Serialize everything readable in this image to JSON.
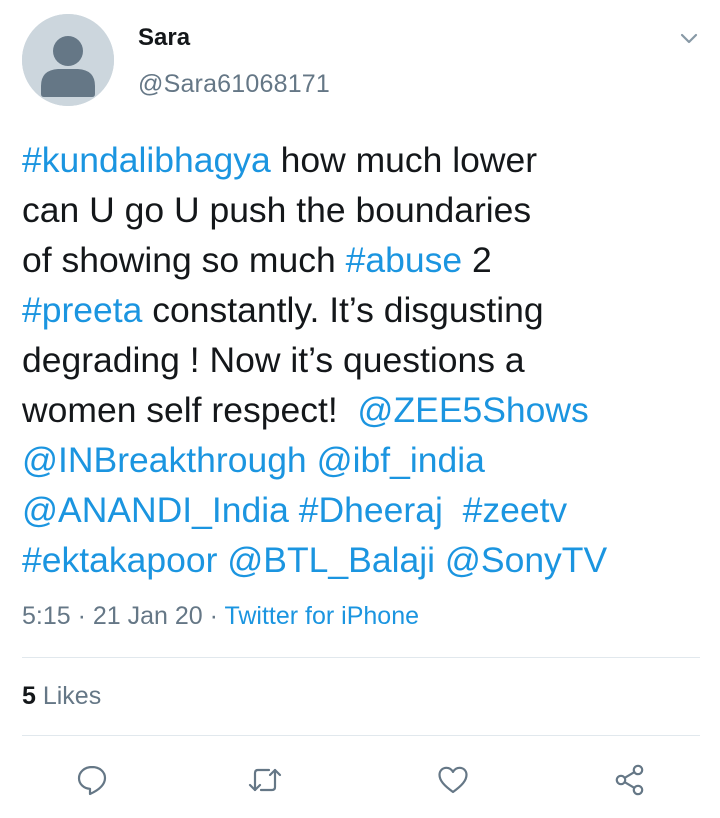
{
  "user": {
    "display_name": "Sara",
    "handle": "@Sara61068171",
    "avatar_icon": "default-avatar-icon"
  },
  "tweet": {
    "lines": [
      [
        {
          "t": "#kundalibhagya",
          "link": true
        },
        {
          "t": " how much lower",
          "link": false
        }
      ],
      [
        {
          "t": "can U go U push the boundaries",
          "link": false
        }
      ],
      [
        {
          "t": "of showing so much ",
          "link": false
        },
        {
          "t": "#abuse",
          "link": true
        },
        {
          "t": " 2",
          "link": false
        }
      ],
      [
        {
          "t": "#preeta",
          "link": true
        },
        {
          "t": " constantly. It’s disgusting",
          "link": false
        }
      ],
      [
        {
          "t": "degrading ! Now it’s questions a",
          "link": false
        }
      ],
      [
        {
          "t": "women self respect!  ",
          "link": false
        },
        {
          "t": "@ZEE5Shows",
          "link": true
        }
      ],
      [
        {
          "t": "@INBreakthrough",
          "link": true
        },
        {
          "t": " ",
          "link": false
        },
        {
          "t": "@ibf_india",
          "link": true
        }
      ],
      [
        {
          "t": "@ANANDI_India",
          "link": true
        },
        {
          "t": " ",
          "link": false
        },
        {
          "t": "#Dheeraj",
          "link": true
        },
        {
          "t": "  ",
          "link": false
        },
        {
          "t": "#zeetv",
          "link": true
        }
      ],
      [
        {
          "t": "#ektakapoor",
          "link": true
        },
        {
          "t": " ",
          "link": false
        },
        {
          "t": "@BTL_Balaji",
          "link": true
        },
        {
          "t": " ",
          "link": false
        },
        {
          "t": "@SonyTV",
          "link": true
        }
      ]
    ]
  },
  "meta": {
    "time": "5:15",
    "sep1": " · ",
    "date": "21 Jan 20",
    "sep2": " · ",
    "source": "Twitter for iPhone"
  },
  "stats": {
    "likes_count": "5",
    "likes_label": " Likes"
  },
  "actions": [
    "reply-icon",
    "retweet-icon",
    "like-icon",
    "share-icon"
  ],
  "colors": {
    "link": "#1b95e0",
    "text": "#14171a",
    "secondary": "#657786",
    "divider": "#e1e8ed",
    "avatar_bg": "#ccd6dd",
    "avatar_fg": "#657786"
  }
}
